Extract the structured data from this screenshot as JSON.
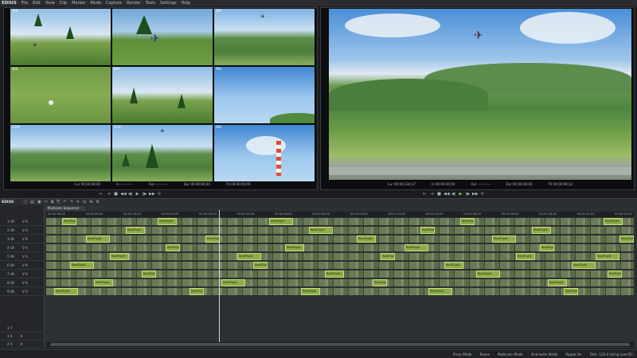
{
  "app": {
    "name": "EDIUS"
  },
  "menu": [
    "File",
    "Edit",
    "View",
    "Clip",
    "Marker",
    "Mode",
    "Capture",
    "Render",
    "Tools",
    "Settings",
    "Help"
  ],
  "source": {
    "cams": [
      {
        "label": "7th"
      },
      {
        "label": ""
      },
      {
        "label": "4th"
      },
      {
        "label": "4th"
      },
      {
        "label": "8th"
      },
      {
        "label": "9th"
      },
      {
        "label": "11th"
      },
      {
        "label": "2nd"
      },
      {
        "label": "6th"
      }
    ],
    "timecodes": {
      "cur": "Cur 00:00:00;00",
      "in": "In --:--:--;--",
      "out": "Out --:--:--;--",
      "dur": "Dur 00:00:00;00",
      "ttl": "Ttl 00:00:00;00"
    }
  },
  "recorder": {
    "timecodes": {
      "cur": "Cur 00:00:134;27",
      "in": "In 00:00:00;00",
      "out": "Out --:--:--;--",
      "dur": "Dur 00:00:00;00",
      "ttl": "Ttl 00:00:00;12"
    }
  },
  "transport_icons": [
    "mark-in-icon",
    "mark-out-icon",
    "stop-icon",
    "rewind-icon",
    "step-back-icon",
    "play-icon",
    "step-forward-icon",
    "fast-forward-icon",
    "loop-icon"
  ],
  "timeline": {
    "title": "EDIUS",
    "sequence_tab": "Multicam Sequence",
    "ruler_ticks": [
      "00:00:00;00",
      "00:00:08;00",
      "00:00:16;00",
      "00:00:24;00",
      "00:00:32;00",
      "00:00:40;00",
      "00:00:48;00",
      "00:00:56;00",
      "00:01:04;00",
      "00:01:12;00",
      "00:01:20;00",
      "00:01:28;00",
      "00:01:36;00",
      "00:01:44;00",
      "00:01:52;00",
      "00:02:00;00"
    ],
    "tracks": [
      {
        "name": "1 VA",
        "flags": "V A"
      },
      {
        "name": "2 VA",
        "flags": "V A"
      },
      {
        "name": "3 VA",
        "flags": "V A"
      },
      {
        "name": "4 VA",
        "flags": "V A"
      },
      {
        "name": "5 VA",
        "flags": "V A"
      },
      {
        "name": "6 VA",
        "flags": "V A"
      },
      {
        "name": "7 VA",
        "flags": "V A"
      },
      {
        "name": "8 VA",
        "flags": "V A"
      },
      {
        "name": "9 VA",
        "flags": "V A"
      },
      {
        "name": "1 T",
        "flags": ""
      },
      {
        "name": "1 A",
        "flags": "A"
      },
      {
        "name": "2 A",
        "flags": "A"
      }
    ],
    "clip_label": "RealFlight"
  },
  "status": {
    "items": [
      "Prmp Mode",
      "Pause",
      "Multicam Mode",
      "Overwrite Mode",
      "Ripple On",
      "Disk: 125.4 /sting over(D:)"
    ]
  },
  "colors": {
    "clip_green": "#8cad4a",
    "play_green": "#6fd54a",
    "panel_bg": "#0c0d0e"
  }
}
